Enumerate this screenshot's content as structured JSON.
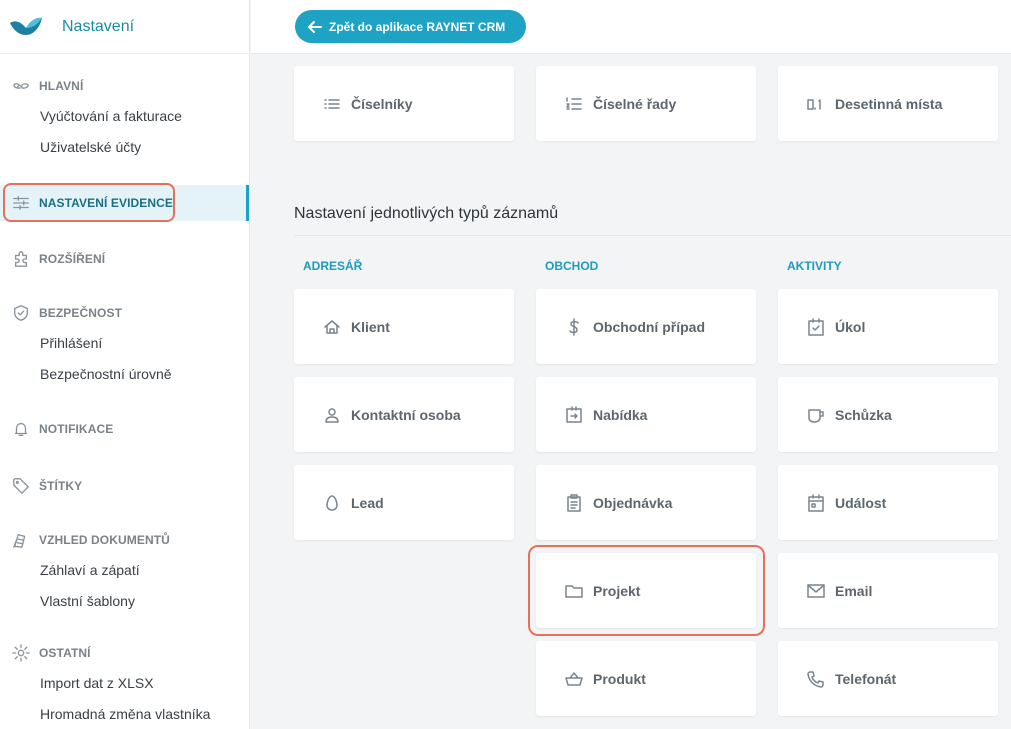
{
  "brand": {
    "title": "Nastavení",
    "logo_icon": "raynet-wave-logo"
  },
  "sidebar": {
    "hlavni": {
      "label": "HLAVNÍ",
      "icon": "hands-icon",
      "items": [
        "Vyúčtování a fakturace",
        "Uživatelské účty"
      ]
    },
    "evidence": {
      "label": "NASTAVENÍ EVIDENCE",
      "icon": "sliders-icon"
    },
    "rozsireni": {
      "label": "ROZŠÍŘENÍ",
      "icon": "puzzle-icon"
    },
    "bezpecnost": {
      "label": "BEZPEČNOST",
      "icon": "shield-check-icon",
      "items": [
        "Přihlášení",
        "Bezpečnostní úrovně"
      ]
    },
    "notifikace": {
      "label": "NOTIFIKACE",
      "icon": "bell-icon"
    },
    "stitky": {
      "label": "ŠTÍTKY",
      "icon": "tag-icon"
    },
    "vzhled": {
      "label": "VZHLED DOKUMENTŮ",
      "icon": "document-icon",
      "items": [
        "Záhlaví a zápatí",
        "Vlastní šablony"
      ]
    },
    "ostatni": {
      "label": "OSTATNÍ",
      "icon": "gear-icon",
      "items": [
        "Import dat z XLSX",
        "Hromadná změna vlastníka"
      ]
    }
  },
  "topbar": {
    "back_label": "Zpět do aplikace RAYNET CRM",
    "back_icon": "arrow-left-icon"
  },
  "top_cards": [
    {
      "label": "Číselníky",
      "icon": "list-icon"
    },
    {
      "label": "Číselné řady",
      "icon": "numbered-list-icon"
    },
    {
      "label": "Desetinná místa",
      "icon": "decimal-icon"
    }
  ],
  "section_title": "Nastavení jednotlivých typů záznamů",
  "columns": {
    "adresar": {
      "label": "ADRESÁŘ",
      "cards": [
        {
          "label": "Klient",
          "icon": "home-icon"
        },
        {
          "label": "Kontaktní osoba",
          "icon": "person-icon"
        },
        {
          "label": "Lead",
          "icon": "egg-icon"
        }
      ]
    },
    "obchod": {
      "label": "OBCHOD",
      "cards": [
        {
          "label": "Obchodní případ",
          "icon": "dollar-icon"
        },
        {
          "label": "Nabídka",
          "icon": "offer-icon"
        },
        {
          "label": "Objednávka",
          "icon": "clipboard-icon"
        },
        {
          "label": "Projekt",
          "icon": "folder-icon"
        },
        {
          "label": "Produkt",
          "icon": "basket-icon"
        }
      ]
    },
    "aktivity": {
      "label": "AKTIVITY",
      "cards": [
        {
          "label": "Úkol",
          "icon": "checkbox-icon"
        },
        {
          "label": "Schůzka",
          "icon": "cup-icon"
        },
        {
          "label": "Událost",
          "icon": "calendar-icon"
        },
        {
          "label": "Email",
          "icon": "envelope-icon"
        },
        {
          "label": "Telefonát",
          "icon": "phone-icon"
        }
      ]
    }
  },
  "colors": {
    "accent": "#1fa3c4",
    "highlight": "#e8705a",
    "active_bg": "#e3f3f8"
  }
}
